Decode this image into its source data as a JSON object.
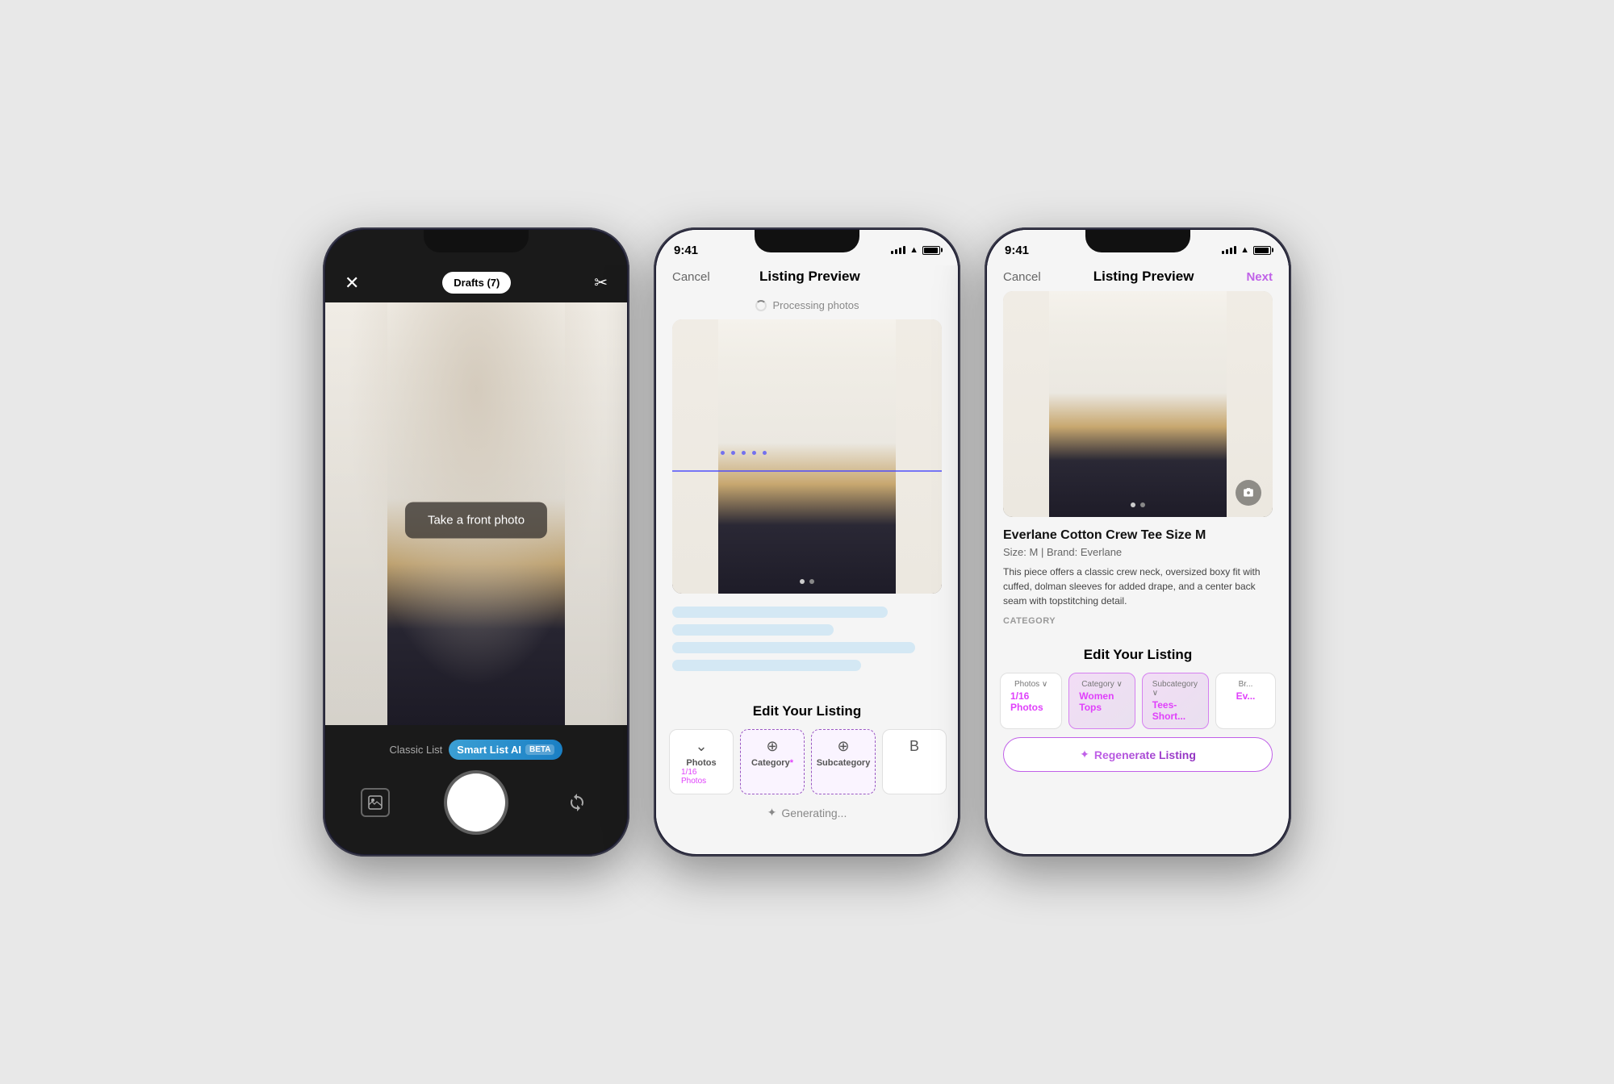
{
  "phones": [
    {
      "id": "phone1",
      "type": "camera",
      "statusBar": {
        "show": false
      },
      "header": {
        "closeBtn": "✕",
        "draftsLabel": "Drafts (7)",
        "scissorsBtn": "✂"
      },
      "viewfinder": {
        "overlayText": "Take a front photo"
      },
      "footer": {
        "classicLabel": "Classic List",
        "smartLabel": "Smart List AI",
        "betaLabel": "BETA"
      }
    },
    {
      "id": "phone2",
      "type": "processing",
      "statusBar": {
        "time": "9:41",
        "show": true
      },
      "navBar": {
        "cancelLabel": "Cancel",
        "title": "Listing Preview",
        "nextLabel": ""
      },
      "processingText": "Processing photos",
      "photoDots": [
        "inactive",
        "active"
      ],
      "editSection": {
        "title": "Edit Your Listing",
        "tabs": [
          {
            "label": "Photos",
            "sublabel": "1/16 Photos",
            "icon": "⌄",
            "active": false
          },
          {
            "label": "Category*",
            "sublabel": "",
            "icon": "⊕",
            "active": true
          },
          {
            "label": "Subcategory",
            "sublabel": "",
            "icon": "⊕",
            "active": true
          },
          {
            "label": "B",
            "sublabel": "",
            "icon": "",
            "active": false
          }
        ]
      },
      "generatingText": "Generating..."
    },
    {
      "id": "phone3",
      "type": "complete",
      "statusBar": {
        "time": "9:41",
        "show": true
      },
      "navBar": {
        "cancelLabel": "Cancel",
        "title": "Listing Preview",
        "nextLabel": "Next"
      },
      "listing": {
        "title": "Everlane Cotton Crew Tee Size M",
        "meta": "Size: M  |  Brand: Everlane",
        "description": "This piece offers a classic crew neck, oversized boxy fit with cuffed, dolman sleeves for added drape, and a center back seam with topstitching detail.",
        "categoryLabel": "CATEGORY"
      },
      "editSection": {
        "title": "Edit Your Listing",
        "tabs": [
          {
            "top": "Photos ∨",
            "value": "1/16 Photos",
            "active": false
          },
          {
            "top": "Category ∨",
            "value": "Women Tops",
            "active": true
          },
          {
            "top": "Subcategory ∨",
            "value": "Tees- Short...",
            "active": true
          },
          {
            "top": "Br...",
            "value": "Ev...",
            "active": false
          }
        ]
      },
      "regenerateBtn": "✦ Regenerate Listing"
    }
  ]
}
